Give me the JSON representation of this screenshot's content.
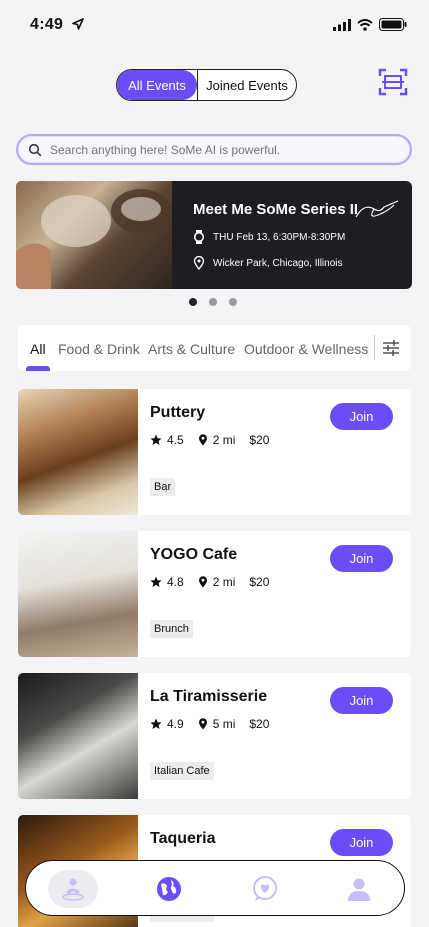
{
  "status_bar": {
    "time": "4:49"
  },
  "segments": {
    "all_events": "All Events",
    "joined_events": "Joined Events"
  },
  "search": {
    "placeholder": "Search anything here! SoMe AI is powerful."
  },
  "banner": {
    "title": "Meet Me SoMe Series II",
    "datetime": "THU Feb 13, 6:30PM-8:30PM",
    "location": "Wicker Park, Chicago, Illinois"
  },
  "carousel": {
    "count": 3,
    "active": 1
  },
  "categories": [
    "All",
    "Food & Drink",
    "Arts & Culture",
    "Outdoor & Wellness"
  ],
  "active_category": "All",
  "join_label": "Join",
  "venues": [
    {
      "name": "Puttery",
      "rating": "4.5",
      "distance": "2 mi",
      "price": "$20",
      "tag": "Bar"
    },
    {
      "name": "YOGO Cafe",
      "rating": "4.8",
      "distance": "2 mi",
      "price": "$20",
      "tag": "Brunch"
    },
    {
      "name": "La Tiramisserie",
      "rating": "4.9",
      "distance": "5 mi",
      "price": "$20",
      "tag": "Italian Cafe"
    },
    {
      "name": "Taqueria",
      "rating": "",
      "distance": "",
      "price": "",
      "tag": "Italian Cafe"
    }
  ],
  "colors": {
    "accent": "#6b4cf6",
    "accent_light": "#b9a6ff",
    "nav_icon": "#c9bdf7"
  },
  "nav": [
    "meditation-icon",
    "globe-icon",
    "heart-chat-icon",
    "profile-icon"
  ]
}
